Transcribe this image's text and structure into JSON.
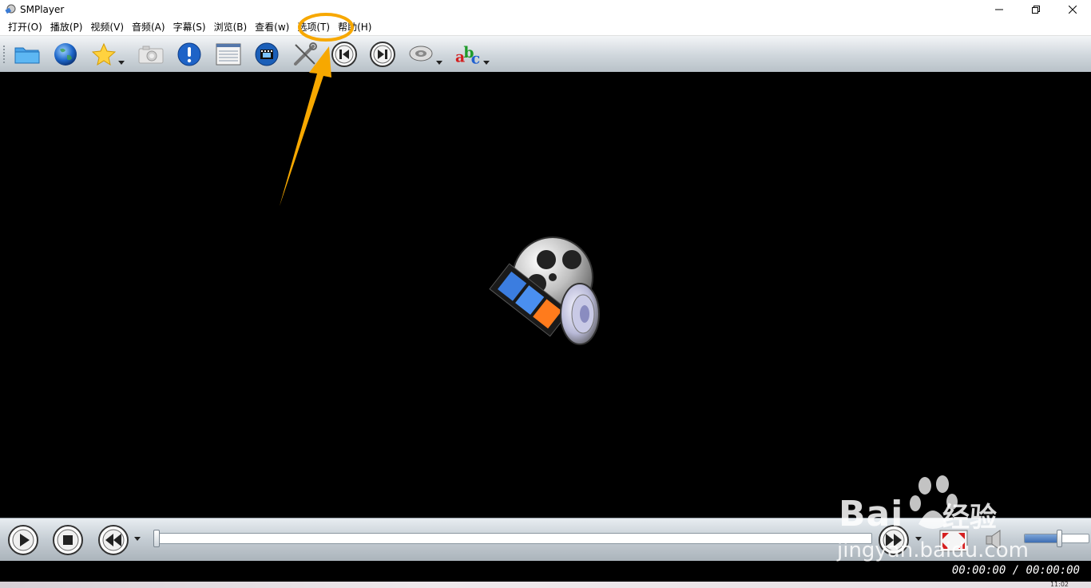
{
  "window": {
    "title": "SMPlayer",
    "controls": [
      "minimize-icon",
      "restore-icon",
      "close-icon"
    ]
  },
  "menu": [
    {
      "id": "open",
      "label": "打开(O)"
    },
    {
      "id": "play",
      "label": "播放(P)"
    },
    {
      "id": "video",
      "label": "视频(V)"
    },
    {
      "id": "audio",
      "label": "音频(A)"
    },
    {
      "id": "subtitles",
      "label": "字幕(S)"
    },
    {
      "id": "browse",
      "label": "浏览(B)"
    },
    {
      "id": "view",
      "label": "查看(w)"
    },
    {
      "id": "options",
      "label": "选项(T)",
      "highlighted": true
    },
    {
      "id": "help",
      "label": "帮助(H)"
    }
  ],
  "toolbar": {
    "icons": [
      "open-folder-icon",
      "open-url-globe-icon",
      "favorites-star-icon",
      "screenshot-camera-icon",
      "info-icon",
      "playlist-icon",
      "youtube-video-icon",
      "preferences-tools-icon",
      "previous-icon",
      "next-icon",
      "audio-track-icon",
      "subtitle-abc-icon"
    ]
  },
  "player": {
    "time": "00:00:00 / 00:00:00",
    "seek_position": 0,
    "volume_level": 0.55
  },
  "watermark": {
    "brand": "Bai",
    "brand_suffix": "经验",
    "url": "jingyan.baidu.com"
  },
  "taskbar": {
    "clock": "11:02"
  },
  "colors": {
    "annotation": "#f7a800",
    "video_background": "#000000"
  }
}
